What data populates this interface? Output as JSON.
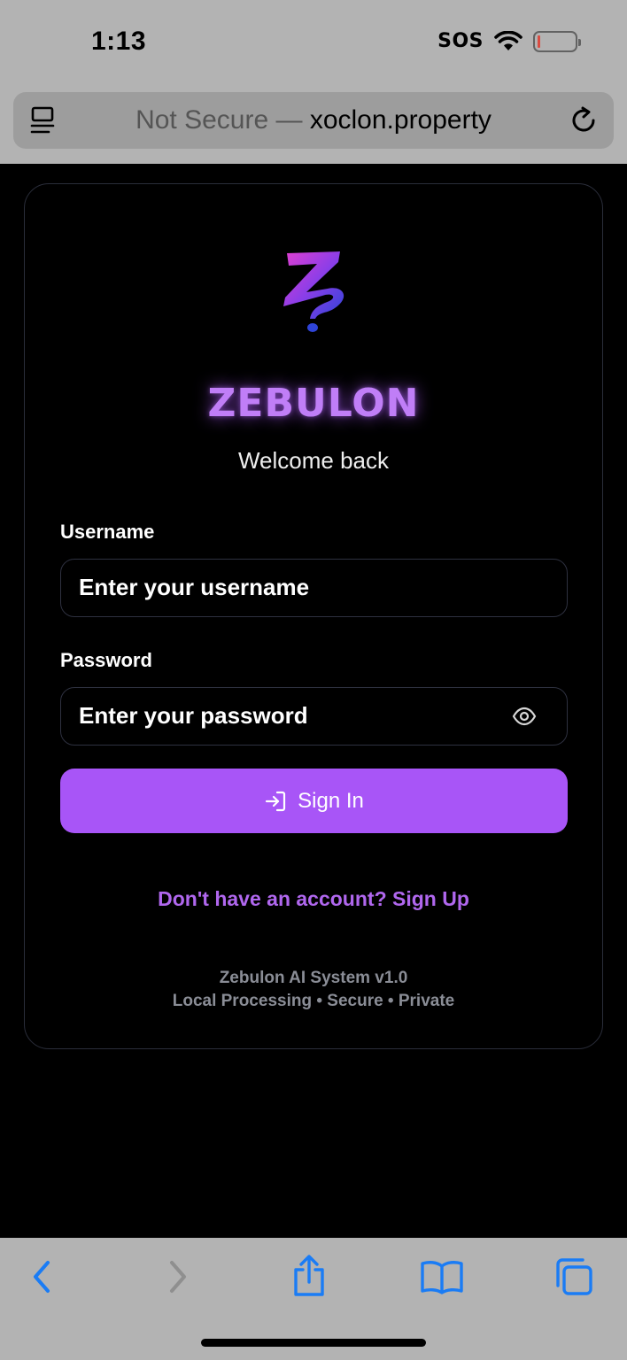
{
  "status_bar": {
    "time": "1:13",
    "sos": "SOS"
  },
  "url_bar": {
    "security": "Not Secure —",
    "domain": "xoclon.property"
  },
  "login": {
    "brand": "ZEBULON",
    "welcome": "Welcome back",
    "username_label": "Username",
    "username_placeholder": "Enter your username",
    "password_label": "Password",
    "password_placeholder": "Enter your password",
    "signin_label": "Sign In",
    "signup_link": "Don't have an account? Sign Up",
    "footer_line1": "Zebulon AI System v1.0",
    "footer_line2": "Local Processing • Secure • Private"
  },
  "colors": {
    "accent": "#a855f7",
    "brand_text": "#c07ef7",
    "link": "#b067ee",
    "toolbar_icon": "#1a7cf5"
  },
  "icons": [
    "reader-icon",
    "reload-icon",
    "logo-icon",
    "eye-icon",
    "sign-in-icon",
    "back-icon",
    "forward-icon",
    "share-icon",
    "bookmarks-icon",
    "tabs-icon"
  ]
}
